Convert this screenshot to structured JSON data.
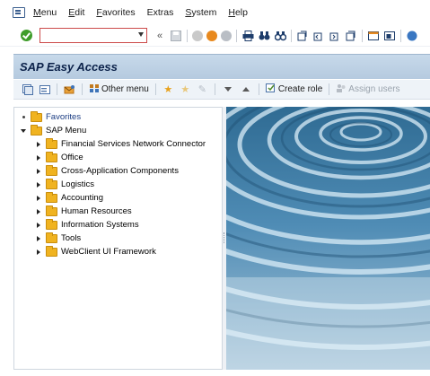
{
  "menubar": {
    "items": [
      {
        "first": "M",
        "rest": "enu"
      },
      {
        "first": "E",
        "rest": "dit"
      },
      {
        "first": "F",
        "rest": "avorites"
      },
      {
        "first": "Extr",
        "rest": "as",
        "underline_index": 3
      },
      {
        "first": "S",
        "rest": "ystem"
      },
      {
        "first": "H",
        "rest": "elp"
      }
    ]
  },
  "toolbar": {
    "command_value": "",
    "command_placeholder": ""
  },
  "title": "SAP Easy Access",
  "app_toolbar": {
    "other_menu": "Other menu",
    "create_role": "Create role",
    "assign_users": "Assign users"
  },
  "tree": {
    "favorites": "Favorites",
    "sap_menu": "SAP Menu",
    "items": [
      "Financial Services Network Connector",
      "Office",
      "Cross-Application Components",
      "Logistics",
      "Accounting",
      "Human Resources",
      "Information Systems",
      "Tools",
      "WebClient UI Framework"
    ]
  },
  "colors": {
    "title_bar": "#c7d9ea",
    "folder": "#f0b320",
    "ok_green": "#3f9d2b",
    "command_border": "#cc4a4a"
  },
  "icons": [
    "app-menu-icon",
    "ok-icon",
    "save-icon",
    "back-icon",
    "exit-icon",
    "cancel-icon",
    "print-icon",
    "find-icon",
    "find-next-icon",
    "first-page-icon",
    "previous-page-icon",
    "next-page-icon",
    "last-page-icon",
    "new-session-icon",
    "shortcut-icon",
    "help-icon"
  ]
}
